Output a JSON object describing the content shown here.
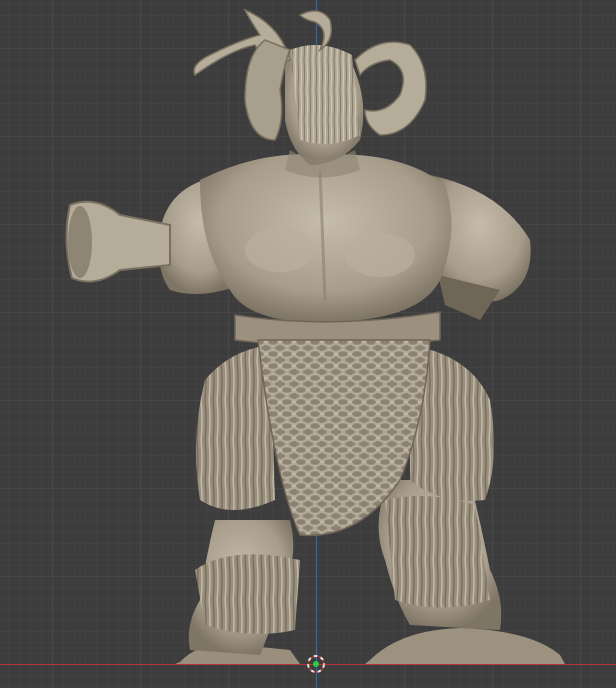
{
  "viewport": {
    "background": "#3d3d3d",
    "grid_color": "#474747",
    "axis_x_color": "#b8343d",
    "axis_z_color": "#2d6fb8",
    "model_color": "#aea392",
    "model_shadow": "#6f6658",
    "model_highlight": "#c9bfae",
    "origin_icon": "3d-cursor-icon",
    "origin_color": "#2ecc40"
  }
}
